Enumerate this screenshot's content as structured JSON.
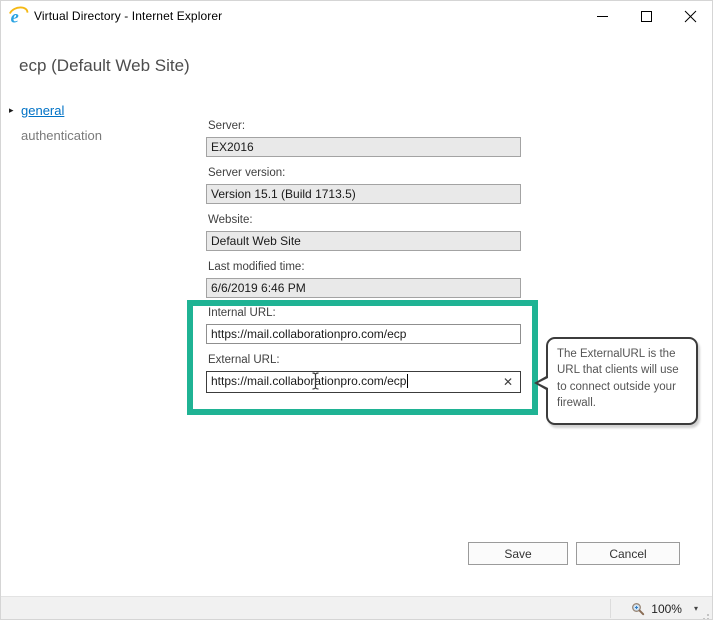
{
  "window": {
    "title": "Virtual Directory - Internet Explorer"
  },
  "page_title": "ecp (Default Web Site)",
  "nav": {
    "arrow_glyph": "▸",
    "items": [
      {
        "label": "general",
        "selected": true
      },
      {
        "label": "authentication",
        "selected": false
      }
    ]
  },
  "form": {
    "fields": [
      {
        "label": "Server:",
        "value": "EX2016",
        "readonly": true
      },
      {
        "label": "Server version:",
        "value": "Version 15.1 (Build 1713.5)",
        "readonly": true
      },
      {
        "label": "Website:",
        "value": "Default Web Site",
        "readonly": true
      },
      {
        "label": "Last modified time:",
        "value": "6/6/2019 6:46 PM",
        "readonly": true
      }
    ],
    "internal_url": {
      "label": "Internal URL:",
      "value": "https://mail.collaborationpro.com/ecp"
    },
    "external_url": {
      "label": "External URL:",
      "value": "https://mail.collaborationpro.com/ecp",
      "clear_glyph": "✕",
      "focused": true
    }
  },
  "tooltip": {
    "text": "The ExternalURL is the URL that clients will use to connect outside your firewall."
  },
  "actions": {
    "save": "Save",
    "cancel": "Cancel"
  },
  "status_bar": {
    "zoom_level": "100%",
    "dropdown_glyph": "▾"
  },
  "icons": {
    "app": "internet-explorer-logo",
    "minimize": "minimize-line",
    "maximize": "maximize-square",
    "close": "close-x",
    "zoom": "magnifier",
    "text_cursor": "i-beam"
  },
  "colors": {
    "highlight_green": "#1fb394",
    "nav_link_blue": "#0072c6",
    "readonly_field_bg": "#e9e9e9"
  }
}
